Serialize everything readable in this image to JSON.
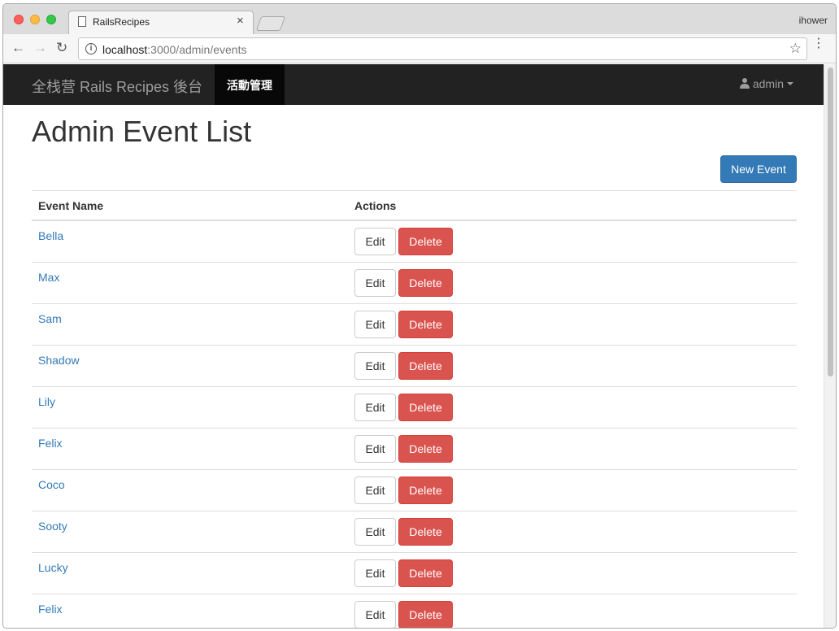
{
  "browser": {
    "tab_title": "RailsRecipes",
    "tab_close": "×",
    "profile_name": "ihower",
    "url_host": "localhost",
    "url_path": ":3000/admin/events",
    "back_glyph": "←",
    "forward_glyph": "→",
    "reload_glyph": "↻",
    "info_glyph": "i",
    "star_glyph": "☆",
    "menu_glyph": "⋮"
  },
  "navbar": {
    "brand": "全栈营 Rails Recipes 後台",
    "active_item": "活動管理",
    "user_label": "admin"
  },
  "main": {
    "title": "Admin Event List",
    "new_button": "New Event",
    "columns": [
      "Event Name",
      "Actions"
    ],
    "edit_label": "Edit",
    "delete_label": "Delete",
    "events": [
      "Bella",
      "Max",
      "Sam",
      "Shadow",
      "Lily",
      "Felix",
      "Coco",
      "Sooty",
      "Lucky",
      "Felix"
    ]
  },
  "colors": {
    "primary": "#337ab7",
    "danger": "#d9534f",
    "navbar_bg": "#222222"
  }
}
